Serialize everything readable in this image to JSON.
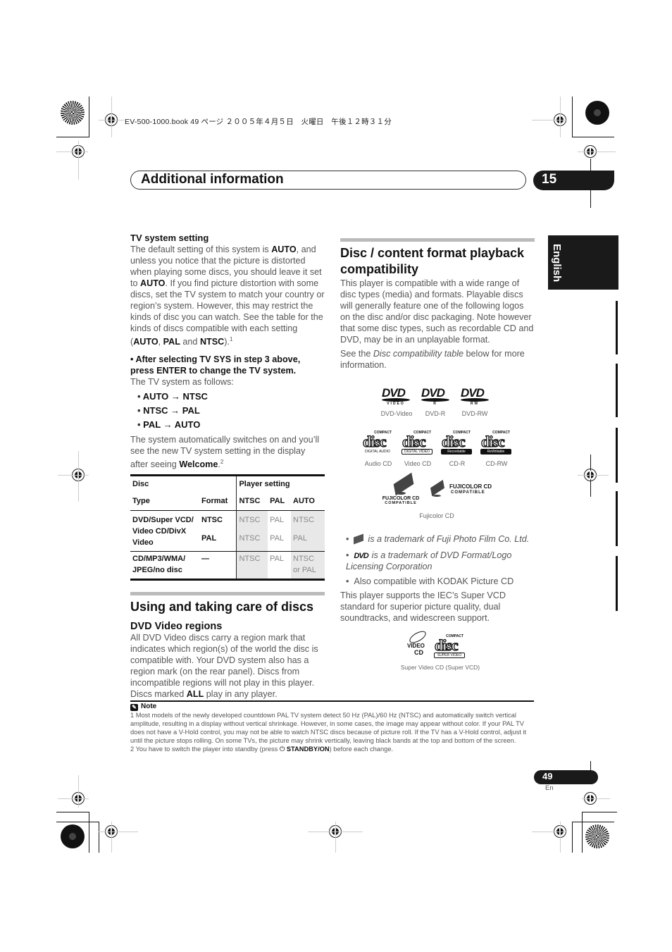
{
  "file_header": "EV-500-1000.book  49 ページ  ２００５年４月５日　火曜日　午後１２時３１分",
  "chapter": {
    "title": "Additional information",
    "number": "15"
  },
  "language_tab": "English",
  "left_column": {
    "tv_system": {
      "heading": "TV system setting",
      "p1_a": "The default setting of this system is ",
      "p1_b1": "AUTO",
      "p1_c": ", and unless you notice that the picture is distorted when playing some discs, you should leave it set to ",
      "p1_b2": "AUTO",
      "p1_d": ". If you find picture distortion with some discs, set the TV system to match your country or region’s system. However, this may restrict the kinds of disc you can watch. See the table for the kinds of discs compatible with each setting (",
      "p1_b3": "AUTO",
      "p1_e": ", ",
      "p1_b4": "PAL",
      "p1_f": " and ",
      "p1_b5": "NTSC",
      "p1_g": ").",
      "p1_sup": "1",
      "step": "•    After selecting TV SYS in step 3 above, press ENTER to change the TV system.",
      "follows": "The TV system as follows:",
      "cycle": [
        "AUTO → NTSC",
        "NTSC → PAL",
        "PAL → AUTO"
      ],
      "p2_a": "The system automatically switches on and you’ll see the new TV system setting in the display after seeing ",
      "p2_b": "Welcome",
      "p2_c": ".",
      "p2_sup": "2"
    },
    "table": {
      "group_disc": "Disc",
      "group_player": "Player setting",
      "col_type": "Type",
      "col_format": "Format",
      "col_ntsc": "NTSC",
      "col_pal": "PAL",
      "col_auto": "AUTO",
      "rows": [
        {
          "type": "DVD/Super VCD/ Video CD/DivX Video",
          "format": "NTSC",
          "ntsc": "NTSC",
          "pal": "PAL",
          "auto": "NTSC"
        },
        {
          "type": "",
          "format": "PAL",
          "ntsc": "NTSC",
          "pal": "PAL",
          "auto": "PAL"
        },
        {
          "type": "CD/MP3/WMA/ JPEG/no disc",
          "format": "—",
          "ntsc": "NTSC",
          "pal": "PAL",
          "auto": "NTSC or PAL"
        }
      ]
    },
    "discs": {
      "heading": "Using and taking care of discs",
      "subheading": "DVD Video regions",
      "p_a": "All DVD Video discs carry a region mark that indicates which region(s) of the world the disc is compatible with. Your DVD system also has a region mark (on the rear panel). Discs from incompatible regions will not play in this player. Discs marked ",
      "p_b": "ALL",
      "p_c": " play in any player."
    }
  },
  "right_column": {
    "heading": "Disc / content format playback compatibility",
    "p1": "This player is compatible with a wide range of disc types (media) and formats. Playable discs will generally feature one of the following logos on the disc and/or disc packaging. Note however that some disc types, such as recordable CD and DVD, may be in an unplayable format.",
    "p2_a": "See the ",
    "p2_i": "Disc compatibility table",
    "p2_b": " below for more information.",
    "dvd_logos": [
      {
        "icon": "dvd-video-logo-icon",
        "sub": "VIDEO",
        "caption": "DVD-Video"
      },
      {
        "icon": "dvd-r-logo-icon",
        "sub": "R",
        "caption": "DVD-R"
      },
      {
        "icon": "dvd-rw-logo-icon",
        "sub": "RW",
        "caption": "DVD-RW"
      }
    ],
    "cd_logos": [
      {
        "icon": "cd-audio-logo-icon",
        "compact": "COMPACT",
        "band": "DIGITAL AUDIO",
        "caption": "Audio CD"
      },
      {
        "icon": "cd-video-logo-icon",
        "compact": "COMPACT",
        "band": "DIGITAL VIDEO",
        "caption": "Video CD"
      },
      {
        "icon": "cd-r-logo-icon",
        "compact": "COMPACT",
        "band": "Recordable",
        "caption": "CD-R"
      },
      {
        "icon": "cd-rw-logo-icon",
        "compact": "COMPACT",
        "band": "ReWritable",
        "caption": "CD-RW"
      }
    ],
    "fujicolor": {
      "line1": "FUJICOLOR CD",
      "line2": "COMPATIBLE",
      "caption": "Fujicolor CD"
    },
    "bullets": [
      "is a trademark of Fuji Photo Film Co. Ltd.",
      "is a trademark of DVD Format/Logo Licensing Corporation",
      "Also compatible with KODAK Picture CD"
    ],
    "svcd_text": "This player supports the IEC’s Super VCD standard for superior picture quality, dual soundtracks, and widescreen support.",
    "svcd_logo": {
      "video": "VIDEO",
      "cd": "CD",
      "compact": "COMPACT",
      "band": "SUPER VIDEO",
      "caption": "Super Video CD (Super VCD)"
    }
  },
  "notes": {
    "title": "Note",
    "n1": "1 Most models of the newly developed countdown PAL TV system detect 50 Hz (PAL)/60 Hz (NTSC) and automatically switch vertical amplitude, resulting in a display without vertical shrinkage. However, in some cases, the image may appear without color. If your PAL TV does not have a V-Hold control, you may not be able to watch NTSC discs because of picture roll. If the TV has a V-Hold control, adjust it until the picture stops rolling. On some TVs, the picture may shrink vertically, leaving black bands at the top and bottom of the screen.",
    "n2_a": "2 You have to switch the player into standby (press ",
    "n2_icon": "⏻",
    "n2_b": "STANDBY/ON",
    "n2_c": ") before each change."
  },
  "page": {
    "number": "49",
    "lang": "En"
  }
}
